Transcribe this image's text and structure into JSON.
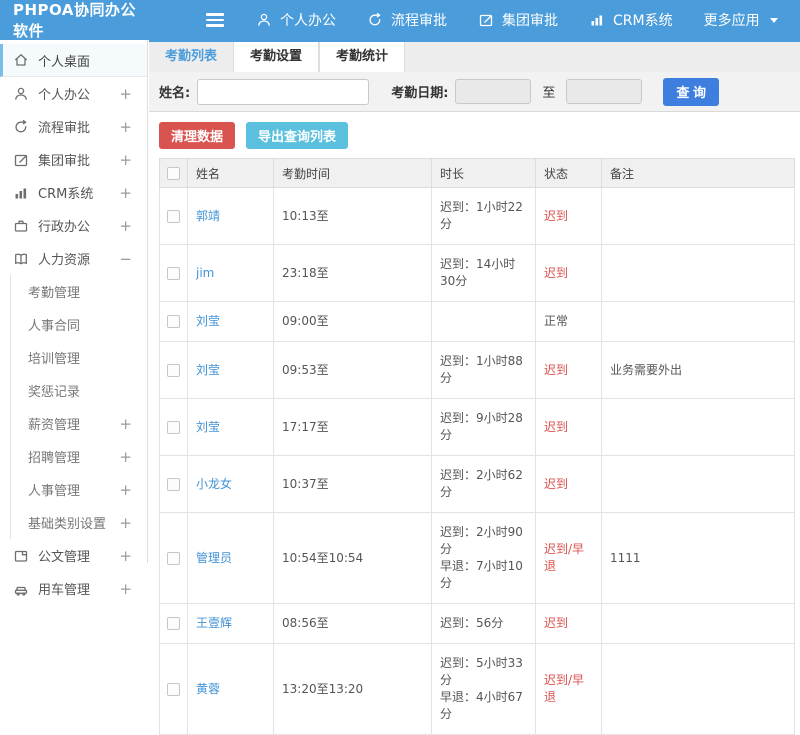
{
  "colors": {
    "topbar": "#4a9cdb",
    "link": "#4193d6",
    "red": "#d9534f",
    "cyan": "#5bc0de",
    "query_blue": "#3d7edf",
    "normal_text": "#555555"
  },
  "topbar": {
    "logo": "PHPOA协同办公软件",
    "nav": [
      {
        "label": "个人办公",
        "icon": "user-icon"
      },
      {
        "label": "流程审批",
        "icon": "flow-icon"
      },
      {
        "label": "集团审批",
        "icon": "edit-icon"
      },
      {
        "label": "CRM系统",
        "icon": "chart-icon"
      },
      {
        "label": "更多应用",
        "icon": "caret-down-icon"
      }
    ]
  },
  "sidebar": {
    "items": [
      {
        "label": "个人桌面",
        "icon": "home-icon",
        "expand": "",
        "active": true
      },
      {
        "label": "个人办公",
        "icon": "user-icon",
        "expand": "+"
      },
      {
        "label": "流程审批",
        "icon": "flow-icon",
        "expand": "+"
      },
      {
        "label": "集团审批",
        "icon": "edit-icon",
        "expand": "+"
      },
      {
        "label": "CRM系统",
        "icon": "chart-icon",
        "expand": "+"
      },
      {
        "label": "行政办公",
        "icon": "briefcase-icon",
        "expand": "+"
      },
      {
        "label": "人力资源",
        "icon": "book-icon",
        "expand": "−"
      },
      {
        "label": "公文管理",
        "icon": "document-icon",
        "expand": "+"
      },
      {
        "label": "用车管理",
        "icon": "car-icon",
        "expand": "+"
      }
    ],
    "hr_sub": [
      {
        "label": "考勤管理",
        "expand": ""
      },
      {
        "label": "人事合同",
        "expand": ""
      },
      {
        "label": "培训管理",
        "expand": ""
      },
      {
        "label": "奖惩记录",
        "expand": ""
      },
      {
        "label": "薪资管理",
        "expand": "+"
      },
      {
        "label": "招聘管理",
        "expand": "+"
      },
      {
        "label": "人事管理",
        "expand": "+"
      },
      {
        "label": "基础类别设置",
        "expand": "+"
      }
    ]
  },
  "tabs": [
    {
      "label": "考勤列表",
      "active": true
    },
    {
      "label": "考勤设置",
      "active": false
    },
    {
      "label": "考勤统计",
      "active": false
    }
  ],
  "filter": {
    "name_label": "姓名:",
    "name_value": "",
    "date_label": "考勤日期:",
    "date_from_value": "",
    "to_label": "至",
    "date_to_value": "",
    "query_button": "查 询"
  },
  "actions": {
    "clean_button": "清理数据",
    "export_button": "导出查询列表"
  },
  "table": {
    "headers": [
      "姓名",
      "考勤时间",
      "时长",
      "状态",
      "备注"
    ],
    "rows": [
      {
        "name": "郭靖",
        "time": "10:13至",
        "duration": "迟到：1小时22分",
        "status": "迟到",
        "status_color": "#d9534f",
        "note": ""
      },
      {
        "name": "jim",
        "time": "23:18至",
        "duration": "迟到：14小时30分",
        "status": "迟到",
        "status_color": "#d9534f",
        "note": ""
      },
      {
        "name": "刘莹",
        "time": "09:00至",
        "duration": "",
        "status": "正常",
        "status_color": "#555555",
        "note": ""
      },
      {
        "name": "刘莹",
        "time": "09:53至",
        "duration": "迟到：1小时88分",
        "status": "迟到",
        "status_color": "#d9534f",
        "note": "业务需要外出"
      },
      {
        "name": "刘莹",
        "time": "17:17至",
        "duration": "迟到：9小时28分",
        "status": "迟到",
        "status_color": "#d9534f",
        "note": ""
      },
      {
        "name": "小龙女",
        "time": "10:37至",
        "duration": "迟到：2小时62分",
        "status": "迟到",
        "status_color": "#d9534f",
        "note": ""
      },
      {
        "name": "管理员",
        "time": "10:54至10:54",
        "duration": "迟到：2小时90分\n早退：7小时10分",
        "status": "迟到/早退",
        "status_color": "#d9534f",
        "note": "1111"
      },
      {
        "name": "王壹辉",
        "time": "08:56至",
        "duration": "迟到：56分",
        "status": "迟到",
        "status_color": "#d9534f",
        "note": ""
      },
      {
        "name": "黄蓉",
        "time": "13:20至13:20",
        "duration": "迟到：5小时33分\n早退：4小时67分",
        "status": "迟到/早退",
        "status_color": "#d9534f",
        "note": ""
      }
    ]
  }
}
